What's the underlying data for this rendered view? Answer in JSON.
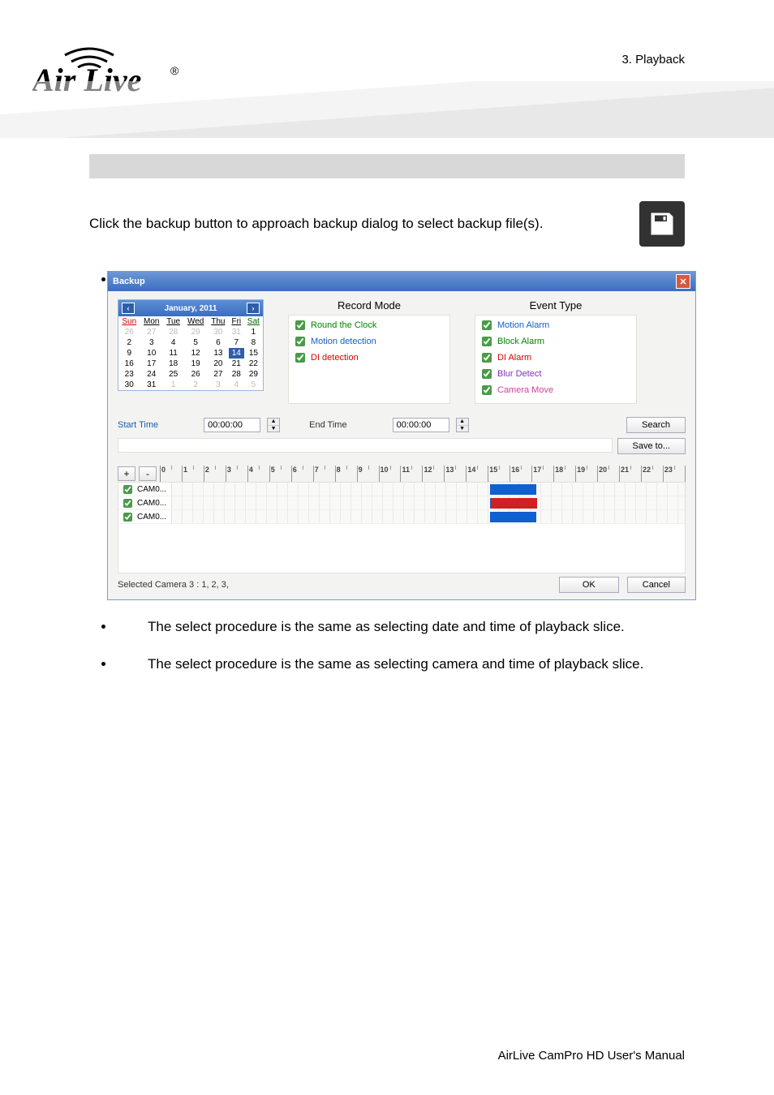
{
  "header": {
    "section": "3.  Playback"
  },
  "intro": "Click the backup button to approach backup dialog to select backup file(s).",
  "dialog": {
    "title": "Backup",
    "calendar": {
      "month": "January, 2011",
      "dow": [
        "Sun",
        "Mon",
        "Tue",
        "Wed",
        "Thu",
        "Fri",
        "Sat"
      ],
      "rows": [
        [
          {
            "d": "26",
            "g": true
          },
          {
            "d": "27",
            "g": true
          },
          {
            "d": "28",
            "g": true
          },
          {
            "d": "29",
            "g": true
          },
          {
            "d": "30",
            "g": true
          },
          {
            "d": "31",
            "g": true
          },
          {
            "d": "1"
          }
        ],
        [
          {
            "d": "2"
          },
          {
            "d": "3"
          },
          {
            "d": "4"
          },
          {
            "d": "5"
          },
          {
            "d": "6"
          },
          {
            "d": "7"
          },
          {
            "d": "8"
          }
        ],
        [
          {
            "d": "9"
          },
          {
            "d": "10"
          },
          {
            "d": "11"
          },
          {
            "d": "12"
          },
          {
            "d": "13"
          },
          {
            "d": "14",
            "sel": true
          },
          {
            "d": "15"
          }
        ],
        [
          {
            "d": "16"
          },
          {
            "d": "17"
          },
          {
            "d": "18"
          },
          {
            "d": "19"
          },
          {
            "d": "20"
          },
          {
            "d": "21"
          },
          {
            "d": "22"
          }
        ],
        [
          {
            "d": "23"
          },
          {
            "d": "24"
          },
          {
            "d": "25"
          },
          {
            "d": "26"
          },
          {
            "d": "27"
          },
          {
            "d": "28"
          },
          {
            "d": "29"
          }
        ],
        [
          {
            "d": "30"
          },
          {
            "d": "31"
          },
          {
            "d": "1",
            "g": true
          },
          {
            "d": "2",
            "g": true
          },
          {
            "d": "3",
            "g": true
          },
          {
            "d": "4",
            "g": true
          },
          {
            "d": "5",
            "g": true
          }
        ]
      ]
    },
    "record_mode": {
      "title": "Record Mode",
      "items": [
        {
          "label": "Round the Clock",
          "cls": "green"
        },
        {
          "label": "Motion detection",
          "cls": "blue"
        },
        {
          "label": "DI detection",
          "cls": "red"
        }
      ]
    },
    "event_type": {
      "title": "Event Type",
      "items": [
        {
          "label": "Motion Alarm",
          "cls": "blue"
        },
        {
          "label": "Block Alarm",
          "cls": "green"
        },
        {
          "label": "DI Alarm",
          "cls": "red"
        },
        {
          "label": "Blur Detect",
          "cls": "purple"
        },
        {
          "label": "Camera Move",
          "cls": "pink"
        }
      ]
    },
    "start_label": "Start Time",
    "end_label": "End Time",
    "start_value": "00:00:00",
    "end_value": "00:00:00",
    "search_btn": "Search",
    "saveto_btn": "Save to...",
    "hours": [
      "0",
      "1",
      "2",
      "3",
      "4",
      "5",
      "6",
      "7",
      "8",
      "9",
      "10",
      "11",
      "12",
      "13",
      "14",
      "15",
      "16",
      "17",
      "18",
      "19",
      "20",
      "21",
      "22",
      "23"
    ],
    "cameras": [
      {
        "label": "CAM0...",
        "segs": [
          {
            "cls": "blue",
            "l": 62,
            "w": 9
          }
        ]
      },
      {
        "label": "CAM0...",
        "segs": [
          {
            "cls": "blue",
            "l": 62,
            "w": 9
          },
          {
            "cls": "red",
            "l": 62.2,
            "w": 9
          }
        ]
      },
      {
        "label": "CAM0...",
        "segs": [
          {
            "cls": "blue",
            "l": 62,
            "w": 9
          }
        ]
      }
    ],
    "selected_text": "Selected Camera 3 : 1, 2, 3,",
    "ok_btn": "OK",
    "cancel_btn": "Cancel"
  },
  "notes": {
    "n1": "The select procedure is the same as selecting date and time of playback slice.",
    "n2": "The select procedure is the same as selecting camera and time of playback slice."
  },
  "footer": "AirLive CamPro HD User's Manual"
}
